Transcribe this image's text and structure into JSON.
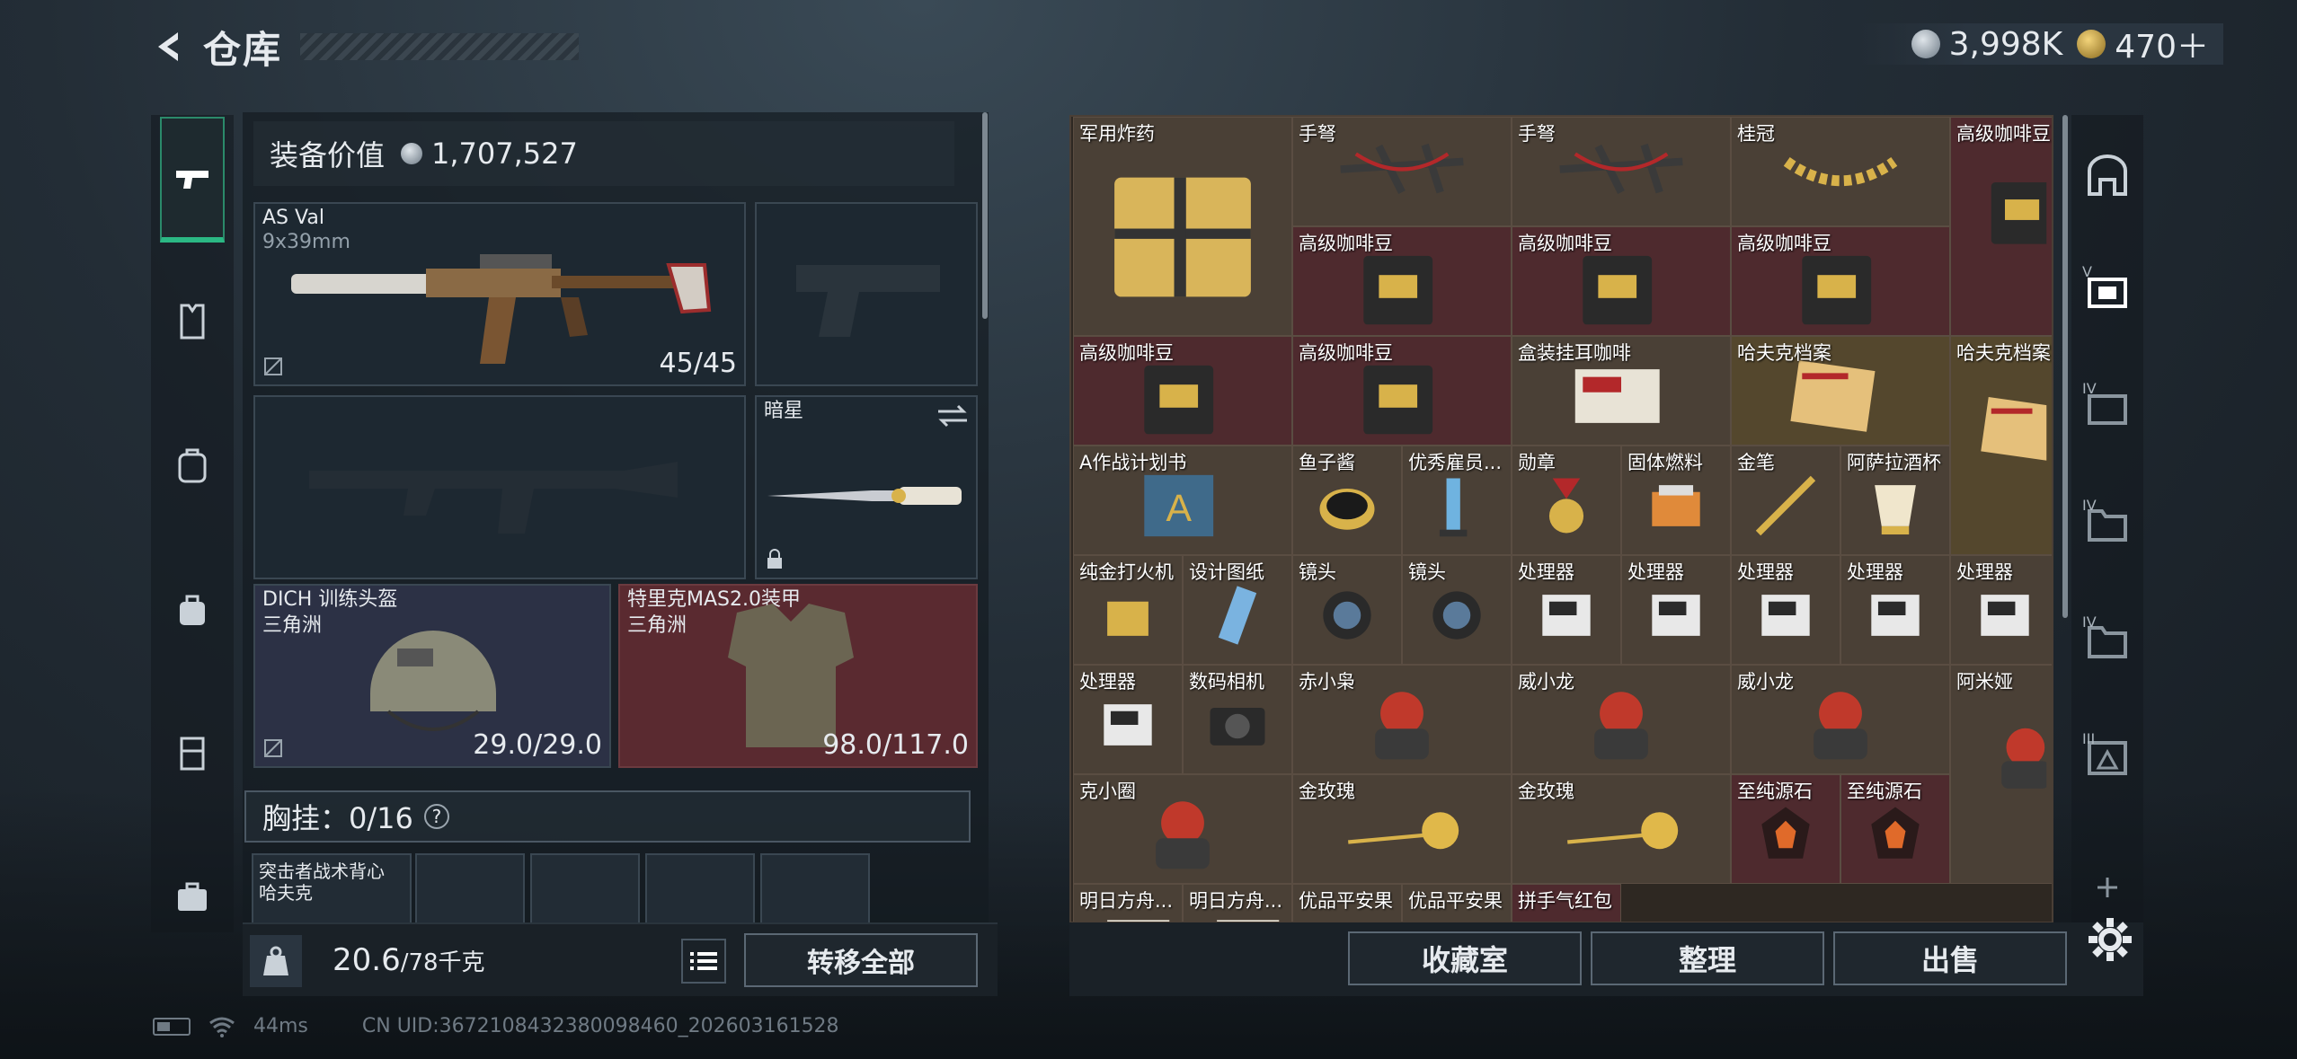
{
  "header": {
    "title": "仓库"
  },
  "currency": {
    "silver": "3,998K",
    "gold": "470＋"
  },
  "left_rail": {
    "items": [
      {
        "name": "weapon-tab",
        "icon": "pistol-icon"
      },
      {
        "name": "armor-tab",
        "icon": "vest-icon"
      },
      {
        "name": "backpack-tab",
        "icon": "backpack-icon"
      },
      {
        "name": "bag-tab",
        "icon": "bag-icon"
      },
      {
        "name": "rig-tab",
        "icon": "rig-icon"
      },
      {
        "name": "case-tab",
        "icon": "briefcase-icon"
      }
    ]
  },
  "equipment": {
    "value_label": "装备价值",
    "value": "1,707,527",
    "primary": {
      "name": "AS Val",
      "ammo": "9x39mm",
      "count": "45/45"
    },
    "melee": {
      "name": "暗星"
    },
    "helmet": {
      "name": "DICH 训练头盔",
      "sub": "三角洲",
      "durability": "29.0/29.0"
    },
    "armor": {
      "name": "特里克MAS2.0装甲",
      "sub": "三角洲",
      "durability": "98.0/117.0"
    },
    "chest_rig": {
      "label": "胸挂：0/16",
      "help": "?"
    },
    "vest": {
      "name": "突击者战术背心",
      "sub": "哈夫克"
    }
  },
  "footer_left": {
    "weight": "20.6",
    "weight_max": "/78千克",
    "transfer": "转移全部"
  },
  "footer_right": {
    "collection": "收藏室",
    "sort": "整理",
    "sell": "出售"
  },
  "stash": {
    "items": [
      {
        "label": "军用炸药"
      },
      {
        "label": "手弩"
      },
      {
        "label": "手弩"
      },
      {
        "label": "桂冠"
      },
      {
        "label": "高级咖啡豆"
      },
      {
        "label": "高级咖啡豆"
      },
      {
        "label": "高级咖啡豆"
      },
      {
        "label": "高级咖啡豆"
      },
      {
        "label": "高级咖啡豆"
      },
      {
        "label": "高级咖啡豆"
      },
      {
        "label": "盒装挂耳咖啡"
      },
      {
        "label": "哈夫克档案"
      },
      {
        "label": "哈夫克档案"
      },
      {
        "label": "A作战计划书"
      },
      {
        "label": "鱼子酱"
      },
      {
        "label": "优秀雇员..."
      },
      {
        "label": "勋章"
      },
      {
        "label": "固体燃料"
      },
      {
        "label": "金笔"
      },
      {
        "label": "阿萨拉酒杯"
      },
      {
        "label": "纯金打火机"
      },
      {
        "label": "设计图纸"
      },
      {
        "label": "镜头"
      },
      {
        "label": "镜头"
      },
      {
        "label": "处理器"
      },
      {
        "label": "处理器"
      },
      {
        "label": "处理器"
      },
      {
        "label": "处理器"
      },
      {
        "label": "处理器"
      },
      {
        "label": "处理器"
      },
      {
        "label": "数码相机"
      },
      {
        "label": "赤小枭"
      },
      {
        "label": "威小龙"
      },
      {
        "label": "威小龙"
      },
      {
        "label": "阿米娅"
      },
      {
        "label": "克小圈"
      },
      {
        "label": "金玫瑰"
      },
      {
        "label": "金玫瑰"
      },
      {
        "label": "至纯源石"
      },
      {
        "label": "至纯源石"
      },
      {
        "label": "明日方舟..."
      },
      {
        "label": "明日方舟..."
      },
      {
        "label": "优品平安果"
      },
      {
        "label": "优品平安果"
      },
      {
        "label": "拼手气红包"
      }
    ]
  },
  "right_rail": {
    "tiers": [
      "V",
      "IV",
      "IV",
      "IV",
      "III"
    ]
  },
  "status": {
    "ping": "44ms",
    "uid": "CN UID:3672108432380098460_202603161528"
  },
  "colors": {
    "accent_green": "#2bb884",
    "red_cell": "#4e2a2e",
    "gold": "#d8b24a"
  }
}
